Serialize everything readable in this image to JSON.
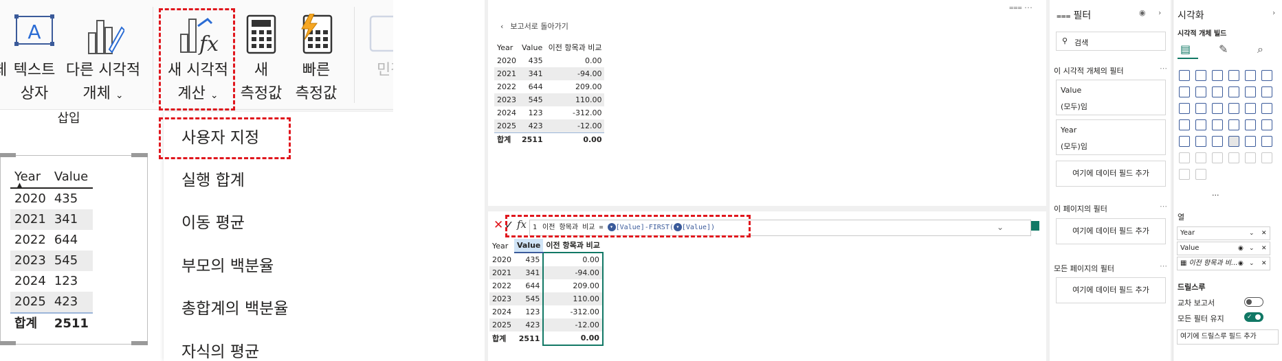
{
  "ribbon": {
    "left_label": "체",
    "textbox": {
      "line1": "텍스트",
      "line2": "상자"
    },
    "other_visual": {
      "line1": "다른 시각적",
      "line2": "개체"
    },
    "insert_group": "삽입",
    "new_visual_calc": {
      "line1": "새 시각적",
      "line2": "계산"
    },
    "new_measure": {
      "line1": "새",
      "line2": "측정값"
    },
    "quick_measure": {
      "line1": "빠른",
      "line2": "측정값"
    },
    "sensitivity": {
      "line1": "민감"
    }
  },
  "dropdown": {
    "items": [
      "사용자 지정",
      "실행 합계",
      "이동 평균",
      "부모의 백분율",
      "총합계의 백분율",
      "자식의 평균"
    ]
  },
  "left_table": {
    "headers": [
      "Year",
      "Value"
    ],
    "rows": [
      [
        "2020",
        "435"
      ],
      [
        "2021",
        "341"
      ],
      [
        "2022",
        "644"
      ],
      [
        "2023",
        "545"
      ],
      [
        "2024",
        "123"
      ],
      [
        "2025",
        "423"
      ]
    ],
    "total": [
      "합계",
      "2511"
    ]
  },
  "canvas": {
    "back_link": "보고서로 돌아가기",
    "headers": [
      "Year",
      "Value",
      "이전 항목과 비교"
    ],
    "rows": [
      [
        "2020",
        "435",
        "0.00"
      ],
      [
        "2021",
        "341",
        "-94.00"
      ],
      [
        "2022",
        "644",
        "209.00"
      ],
      [
        "2023",
        "545",
        "110.00"
      ],
      [
        "2024",
        "123",
        "-312.00"
      ],
      [
        "2025",
        "423",
        "-12.00"
      ]
    ],
    "total": [
      "합계",
      "2511",
      "0.00"
    ]
  },
  "formula": {
    "line_no": "1",
    "name": "이전 항목과 비교",
    "op": "=",
    "part1": "[Value]-FIRST(",
    "part2": "[Value])"
  },
  "editor_table": {
    "headers": [
      "Year",
      "Value",
      "이전 항목과 비교"
    ],
    "rows": [
      [
        "2020",
        "435",
        "0.00"
      ],
      [
        "2021",
        "341",
        "-94.00"
      ],
      [
        "2022",
        "644",
        "209.00"
      ],
      [
        "2023",
        "545",
        "110.00"
      ],
      [
        "2024",
        "123",
        "-312.00"
      ],
      [
        "2025",
        "423",
        "-12.00"
      ]
    ],
    "total": [
      "합계",
      "2511",
      "0.00"
    ]
  },
  "filters": {
    "title": "필터",
    "search_placeholder": "검색",
    "visual_section": "이 시각적 개체의 필터",
    "card1_field": "Value",
    "card1_value": "(모두)임",
    "card2_field": "Year",
    "card2_value": "(모두)임",
    "add_field": "여기에 데이터 필드 추가",
    "page_section": "이 페이지의 필터",
    "all_section": "모든 페이지의 필터"
  },
  "viz": {
    "title": "시각화",
    "build": "시각적 개체 빌드",
    "more_label": "...",
    "columns_section": "열",
    "fields": [
      "Year",
      "Value",
      "이전 항목과 비..."
    ],
    "drill_section": "드릴스루",
    "cross_report": "교차 보고서",
    "keep_filters": "모든 필터 유지",
    "add_drill": "여기에 드릴스루 필드 추가",
    "next_tab": "D"
  },
  "colors": {
    "accent_red": "#e0161d",
    "teal": "#117865",
    "toggle_on": "#117865"
  }
}
